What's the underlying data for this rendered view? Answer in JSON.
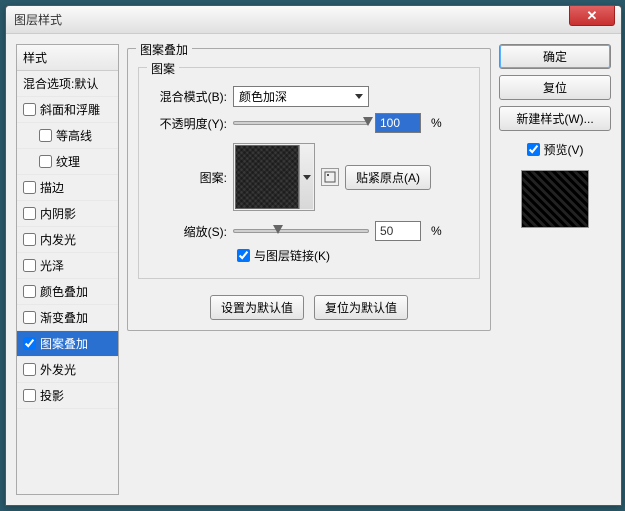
{
  "dialog": {
    "title": "图层样式"
  },
  "styleList": {
    "header": "样式",
    "blendingDefault": "混合选项:默认",
    "items": [
      {
        "label": "斜面和浮雕",
        "checked": false,
        "indent": false
      },
      {
        "label": "等高线",
        "checked": false,
        "indent": true
      },
      {
        "label": "纹理",
        "checked": false,
        "indent": true
      },
      {
        "label": "描边",
        "checked": false,
        "indent": false
      },
      {
        "label": "内阴影",
        "checked": false,
        "indent": false
      },
      {
        "label": "内发光",
        "checked": false,
        "indent": false
      },
      {
        "label": "光泽",
        "checked": false,
        "indent": false
      },
      {
        "label": "颜色叠加",
        "checked": false,
        "indent": false
      },
      {
        "label": "渐变叠加",
        "checked": false,
        "indent": false
      },
      {
        "label": "图案叠加",
        "checked": true,
        "indent": false,
        "selected": true
      },
      {
        "label": "外发光",
        "checked": false,
        "indent": false
      },
      {
        "label": "投影",
        "checked": false,
        "indent": false
      }
    ]
  },
  "center": {
    "panelTitle": "图案叠加",
    "innerTitle": "图案",
    "blendModeLabel": "混合模式(B):",
    "blendModeValue": "颜色加深",
    "opacityLabel": "不透明度(Y):",
    "opacityValue": "100",
    "pct": "%",
    "patternLabel": "图案:",
    "snapBtn": "贴紧原点(A)",
    "scaleLabel": "缩放(S):",
    "scaleValue": "50",
    "linkLayerLabel": "与图层链接(K)",
    "linkLayerChecked": true,
    "setDefault": "设置为默认值",
    "resetDefault": "复位为默认值"
  },
  "right": {
    "ok": "确定",
    "cancel": "复位",
    "newStyle": "新建样式(W)...",
    "previewLabel": "预览(V)",
    "previewChecked": true
  }
}
